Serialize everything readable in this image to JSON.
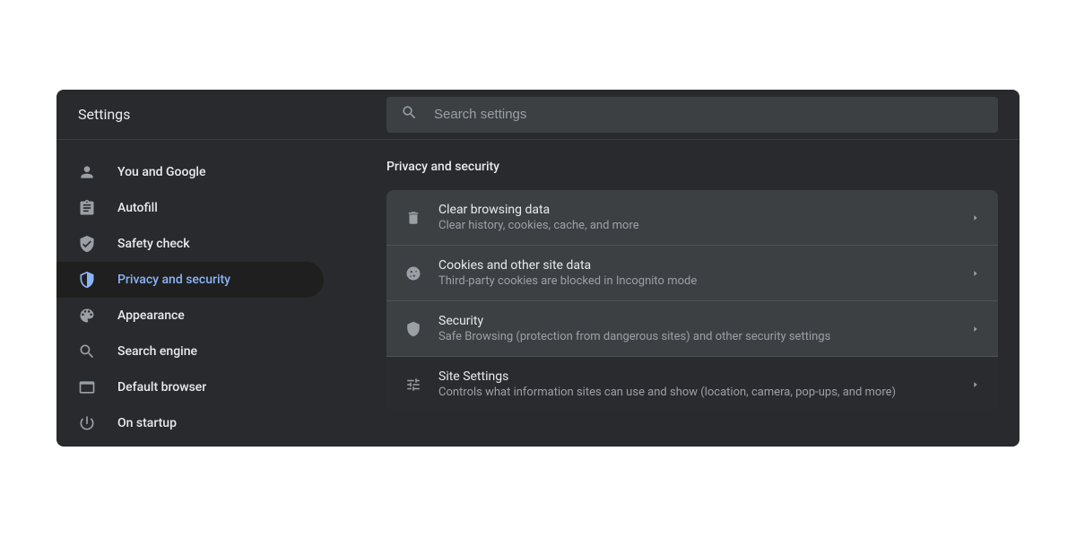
{
  "header": {
    "title": "Settings",
    "search_placeholder": "Search settings"
  },
  "sidebar": {
    "items": [
      {
        "id": "you-and-google",
        "label": "You and Google"
      },
      {
        "id": "autofill",
        "label": "Autofill"
      },
      {
        "id": "safety-check",
        "label": "Safety check"
      },
      {
        "id": "privacy-and-security",
        "label": "Privacy and security",
        "active": true
      },
      {
        "id": "appearance",
        "label": "Appearance"
      },
      {
        "id": "search-engine",
        "label": "Search engine"
      },
      {
        "id": "default-browser",
        "label": "Default browser"
      },
      {
        "id": "on-startup",
        "label": "On startup"
      }
    ]
  },
  "main": {
    "section_title": "Privacy and security",
    "rows": [
      {
        "id": "clear-browsing-data",
        "title": "Clear browsing data",
        "subtitle": "Clear history, cookies, cache, and more"
      },
      {
        "id": "cookies",
        "title": "Cookies and other site data",
        "subtitle": "Third-party cookies are blocked in Incognito mode"
      },
      {
        "id": "security",
        "title": "Security",
        "subtitle": "Safe Browsing (protection from dangerous sites) and other security settings"
      },
      {
        "id": "site-settings",
        "title": "Site Settings",
        "subtitle": "Controls what information sites can use and show (location, camera, pop-ups, and more)",
        "dark": true
      }
    ]
  }
}
